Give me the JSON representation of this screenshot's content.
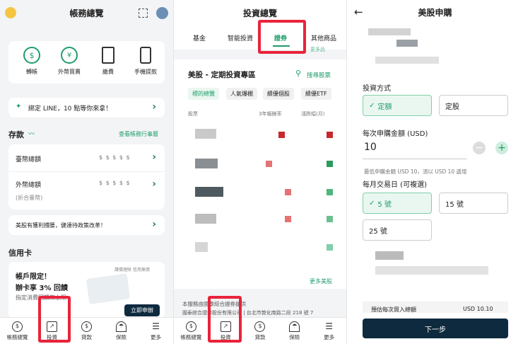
{
  "p1": {
    "title": "帳務總覽",
    "actions": [
      "轉帳",
      "外幣買賣",
      "繳費",
      "手機提款"
    ],
    "line_banner": "綁定 LINE，10 點等你來拿！",
    "deposit_heading": "存款",
    "deposit_link": "查看帳務行事曆",
    "twd_label": "臺幣總額",
    "twd_mask": "$ $ $ $ $",
    "fx_label": "外幣總額",
    "fx_sub": "(折合臺幣)",
    "fx_mask": "$ $ $ $ $",
    "promo": "美股有獲利撐腰，健達待政策改革！",
    "cc_heading": "信用卡",
    "cc_top": "護僑理財 信用無價",
    "cc_title1": "帳戶限定！",
    "cc_title2": "辦卡享 3% 回饋",
    "cc_sub": "指定消費回饋無上限",
    "cc_btn": "立即申辦"
  },
  "nav": [
    "帳務總覽",
    "投資",
    "貸款",
    "保險",
    "更多"
  ],
  "p2": {
    "title": "投資總覽",
    "tabs": [
      "基金",
      "智能投資",
      "證券",
      "其他商品"
    ],
    "under_tab": "更多品",
    "section_title": "美股 - 定期投資專區",
    "search": "搜尋股票",
    "chips": [
      "標的總覽",
      "人氣爆棚",
      "績優個股",
      "績優ETF"
    ],
    "col_stock": "股票",
    "col_rate": "3年報酬率",
    "col_change": "漲跌幅(月)",
    "more": "更多美股",
    "footer1": "本服務由國泰綜合證券提供",
    "footer2": "國泰綜合證券股份有限公司 | 台北市敦化南路二段 218 號 7"
  },
  "p3": {
    "title": "美股申購",
    "method_label": "投資方式",
    "method_opts": [
      "定額",
      "定股"
    ],
    "amount_label": "每次申購金額 (USD)",
    "amount_value": "10",
    "hint": "最低申購金額 USD 10，須以 USD 10 遞增",
    "day_label": "每月交易日 (可複選)",
    "day_opts": [
      "5 號",
      "15 號",
      "25 號"
    ],
    "total_label": "預估每次買入總額",
    "total_value": "USD 10.10",
    "next": "下一步"
  },
  "colors": {
    "accent": "#1f9d6b",
    "dark": "#0e2a3f",
    "highlight": "#e8243b"
  }
}
